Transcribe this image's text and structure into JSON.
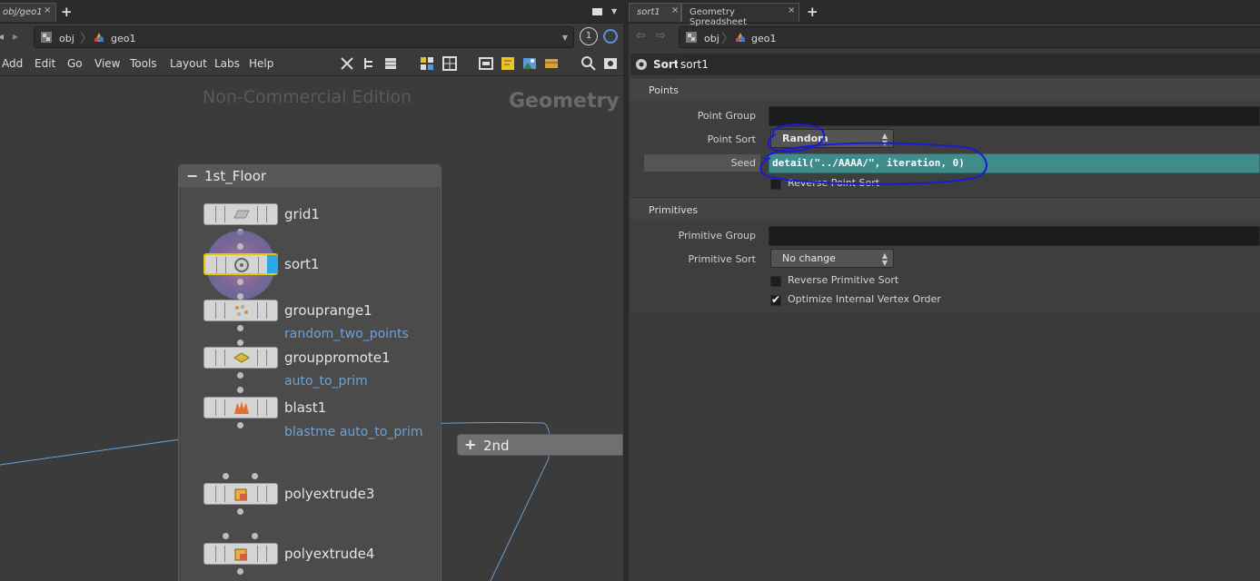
{
  "left_pane": {
    "tab_label": "obj/geo1",
    "path": {
      "root": "obj",
      "current": "geo1"
    },
    "badge": "1",
    "menu": [
      "Add",
      "Edit",
      "Go",
      "View",
      "Tools",
      "Layout",
      "Labs",
      "Help"
    ],
    "watermark": "Non-Commercial Edition",
    "context_label": "Geometry",
    "netbox_title": "1st_Floor",
    "nodes": [
      {
        "name": "grid1",
        "sub": ""
      },
      {
        "name": "sort1",
        "sub": ""
      },
      {
        "name": "grouprange1",
        "sub": "random_two_points"
      },
      {
        "name": "grouppromote1",
        "sub": "auto_to_prim"
      },
      {
        "name": "blast1",
        "sub": "blastme auto_to_prim"
      },
      {
        "name": "polyextrude3",
        "sub": ""
      },
      {
        "name": "polyextrude4",
        "sub": ""
      }
    ],
    "collapsed_box": "2nd"
  },
  "right_pane": {
    "tabs": [
      "sort1",
      "Geometry Spreadsheet"
    ],
    "path": {
      "root": "obj",
      "current": "geo1"
    },
    "node_type": "Sort",
    "node_name": "sort1",
    "sections": {
      "points": "Points",
      "primitives": "Primitives"
    },
    "params": {
      "point_group_label": "Point Group",
      "point_group_value": "",
      "point_sort_label": "Point Sort",
      "point_sort_value": "Random",
      "seed_label": "Seed",
      "seed_value": "detail(\"../AAAA/\", iteration, 0)",
      "reverse_point_sort": "Reverse Point Sort",
      "primitive_group_label": "Primitive Group",
      "primitive_group_value": "",
      "primitive_sort_label": "Primitive Sort",
      "primitive_sort_value": "No change",
      "reverse_primitive_sort": "Reverse Primitive Sort",
      "optimize_vertex_order": "Optimize Internal Vertex Order",
      "optimize_checked": true
    }
  },
  "colors": {
    "seed_field": "#3f8c8a",
    "annotation": "#1a1ad6",
    "selected_node": "#e6c800",
    "display_flag": "#2aa8e8",
    "network_label": "#6ea1d6"
  }
}
